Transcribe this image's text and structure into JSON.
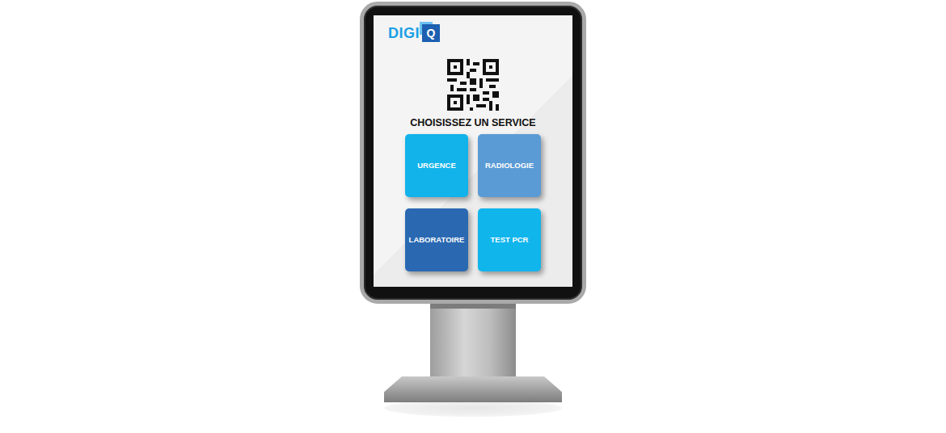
{
  "logo": {
    "text": "DIGI",
    "badge": "Q"
  },
  "heading": "CHOISISSEZ UN SERVICE",
  "services": [
    {
      "label": "URGENCE",
      "color": "#12b3ea"
    },
    {
      "label": "RADIOLOGIE",
      "color": "#5b9bd5"
    },
    {
      "label": "LABORATOIRE",
      "color": "#2a69b2"
    },
    {
      "label": "TEST PCR",
      "color": "#10b5ec"
    }
  ]
}
